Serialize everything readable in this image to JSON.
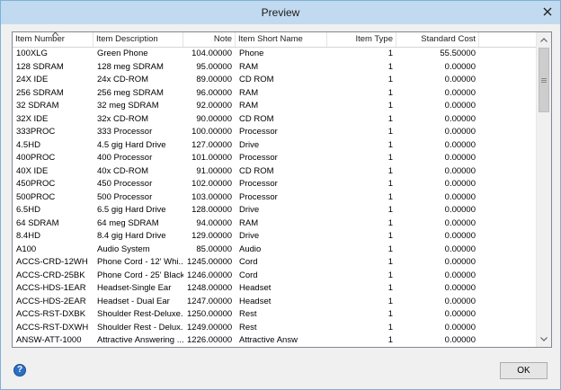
{
  "window": {
    "title": "Preview"
  },
  "columns": [
    "Item Number",
    "Item Description",
    "Note",
    "Item Short Name",
    "Item Type",
    "Standard Cost"
  ],
  "rows": [
    [
      "100XLG",
      "Green Phone",
      "104.00000",
      "Phone",
      "1",
      "55.50000"
    ],
    [
      "128 SDRAM",
      "128 meg SDRAM",
      "95.00000",
      "RAM",
      "1",
      "0.00000"
    ],
    [
      "24X IDE",
      "24x CD-ROM",
      "89.00000",
      "CD ROM",
      "1",
      "0.00000"
    ],
    [
      "256 SDRAM",
      "256 meg SDRAM",
      "96.00000",
      "RAM",
      "1",
      "0.00000"
    ],
    [
      "32 SDRAM",
      "32 meg SDRAM",
      "92.00000",
      "RAM",
      "1",
      "0.00000"
    ],
    [
      "32X IDE",
      "32x CD-ROM",
      "90.00000",
      "CD ROM",
      "1",
      "0.00000"
    ],
    [
      "333PROC",
      "333 Processor",
      "100.00000",
      "Processor",
      "1",
      "0.00000"
    ],
    [
      "4.5HD",
      "4.5 gig Hard Drive",
      "127.00000",
      "Drive",
      "1",
      "0.00000"
    ],
    [
      "400PROC",
      "400 Processor",
      "101.00000",
      "Processor",
      "1",
      "0.00000"
    ],
    [
      "40X IDE",
      "40x CD-ROM",
      "91.00000",
      "CD ROM",
      "1",
      "0.00000"
    ],
    [
      "450PROC",
      "450 Processor",
      "102.00000",
      "Processor",
      "1",
      "0.00000"
    ],
    [
      "500PROC",
      "500 Processor",
      "103.00000",
      "Processor",
      "1",
      "0.00000"
    ],
    [
      "6.5HD",
      "6.5 gig Hard Drive",
      "128.00000",
      "Drive",
      "1",
      "0.00000"
    ],
    [
      "64 SDRAM",
      "64 meg SDRAM",
      "94.00000",
      "RAM",
      "1",
      "0.00000"
    ],
    [
      "8.4HD",
      "8.4 gig Hard Drive",
      "129.00000",
      "Drive",
      "1",
      "0.00000"
    ],
    [
      "A100",
      "Audio System",
      "85.00000",
      "Audio",
      "1",
      "0.00000"
    ],
    [
      "ACCS-CRD-12WH",
      "Phone Cord - 12' Whi...",
      "1245.00000",
      "Cord",
      "1",
      "0.00000"
    ],
    [
      "ACCS-CRD-25BK",
      "Phone Cord - 25' Black",
      "1246.00000",
      "Cord",
      "1",
      "0.00000"
    ],
    [
      "ACCS-HDS-1EAR",
      "Headset-Single Ear",
      "1248.00000",
      "Headset",
      "1",
      "0.00000"
    ],
    [
      "ACCS-HDS-2EAR",
      "Headset - Dual Ear",
      "1247.00000",
      "Headset",
      "1",
      "0.00000"
    ],
    [
      "ACCS-RST-DXBK",
      "Shoulder Rest-Deluxe...",
      "1250.00000",
      "Rest",
      "1",
      "0.00000"
    ],
    [
      "ACCS-RST-DXWH",
      "Shoulder Rest - Delux...",
      "1249.00000",
      "Rest",
      "1",
      "0.00000"
    ],
    [
      "ANSW-ATT-1000",
      "Attractive Answering ...",
      "1226.00000",
      "Attractive Answ",
      "1",
      "0.00000"
    ]
  ],
  "buttons": {
    "ok": "OK",
    "help": "?"
  },
  "scrollbar": {
    "position": 0.0
  }
}
